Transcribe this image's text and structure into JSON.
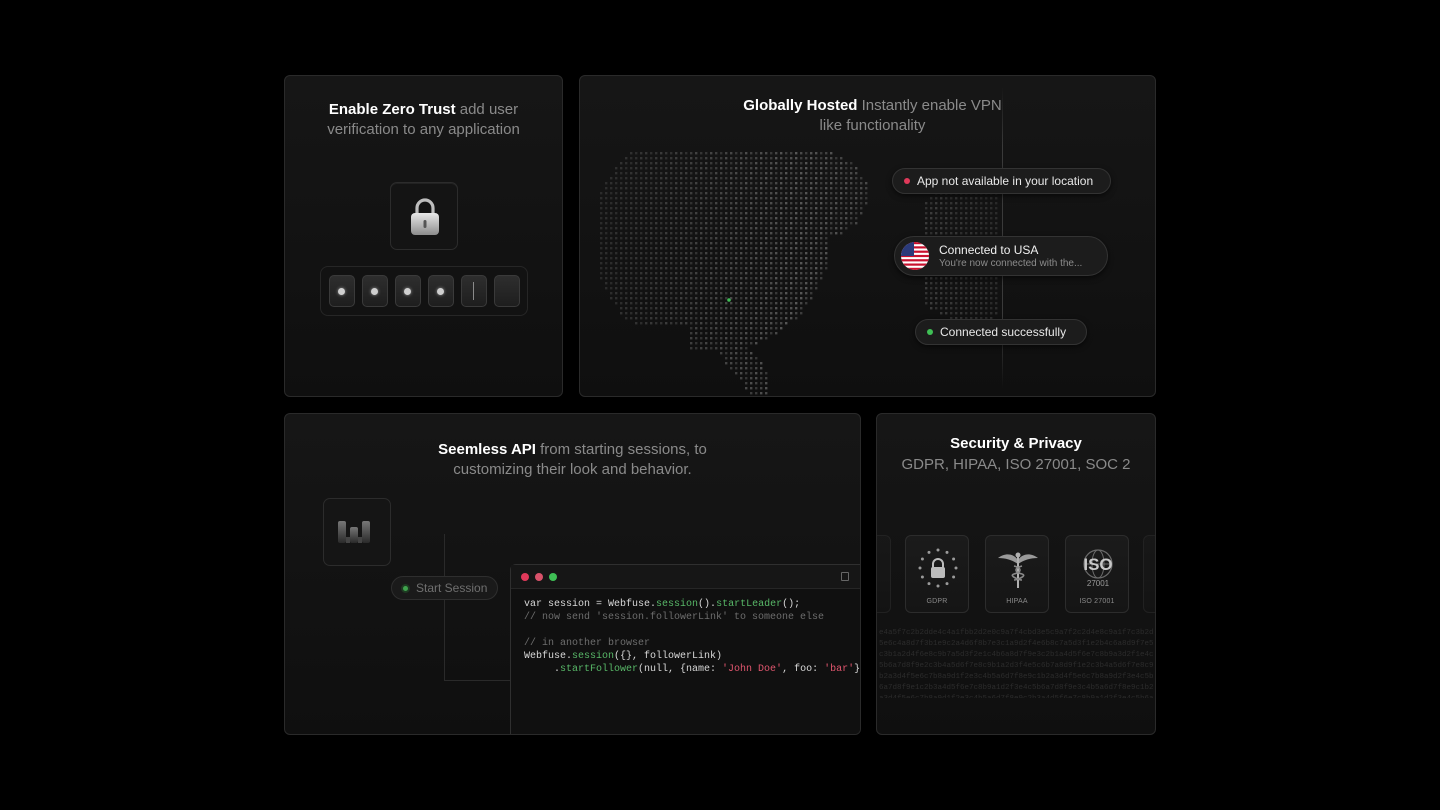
{
  "zero_trust": {
    "title_bold": "Enable Zero Trust",
    "title_rest": " add user verification to any application",
    "pin_slots": 6,
    "pin_filled": 4
  },
  "global": {
    "title_bold": "Globally Hosted",
    "title_rest": " Instantly enable VPN like functionality",
    "pill_unavailable": "App not available in your location",
    "usa_title": "Connected to USA",
    "usa_sub": "You're now connected with the...",
    "pill_success": "Connected successfully",
    "colors": {
      "error": "#e0395a",
      "success": "#3fbf55"
    }
  },
  "api": {
    "title_bold": "Seemless API",
    "title_rest": " from starting sessions, to customizing their look and behavior.",
    "start_session": "Start Session",
    "code": {
      "l1a": "var session = Webfuse.",
      "l1b": "session",
      "l1c": "().",
      "l1d": "startLeader",
      "l1e": "();",
      "l2": "// now send 'session.followerLink' to someone else",
      "l3": "// in another browser",
      "l4a": "Webfuse.",
      "l4b": "session",
      "l4c": "({}, followerLink)",
      "l5a": "     .",
      "l5b": "startFollower",
      "l5c": "(null, {name: ",
      "l5d": "'John Doe'",
      "l5e": ", foo: ",
      "l5f": "'bar'",
      "l5g": "});"
    }
  },
  "security": {
    "title": "Security & Privacy",
    "subtitle": "GDPR, HIPAA, ISO 27001, SOC 2",
    "badges": [
      "GDPR",
      "HIPAA",
      "ISO 27001"
    ],
    "iso_logo": "ISO",
    "iso_number": "27001",
    "hash_text": "e4a5f7c2b2dde4c4a1fbb2d2e0c9a7f4cbd3e5c9a7f2c2d4e8c9a1f7c3b2d5e6c4a8d7f3b1e9c2a4d6f8b7e3c1a9d2f4e6b8c7a5d3f1e2b4c6a8d9f7e5c3b1a2d4f6e8c9b7a5d3f2e1c4b6a8d7f9e3c2b1a4d5f6e7c8b9a3d2f1e4c5b6a7d8f9e2c3b4a5d6f7e8c9b1a2d3f4e5c6b7a8d9f1e2c3b4a5d6f7e8c9b2a3d4f5e6c7b8a9d1f2e3c4b5a6d7f8e9c1b2a3d4f5e6c7b8a9d2f3e4c5b6a7d8f9e1c2b3a4d5f6e7c8b9a1d2f3e4c5b6a7d8f9e3c4b5a6d7f8e9c1b2a3d4f5e6c7b8a9d1f2e3c4b5a6d7f8e9c2b3a4d5f6e7c8b9a1d2f3e4c5b6a7d8f9e1c2b3a4d5f6e7c8b9a2d3f4e5c6b7a8d9f1e2c3b4a5d6f7e8c9b1a2d3f4e5c6b7a8d9f2e3c4b5a6d7f8e9c1b2a3d4f5e6c7b8a9d2f3e4c5b6a7d8f9e1c2b3a4d5f6e7c8b9"
  }
}
